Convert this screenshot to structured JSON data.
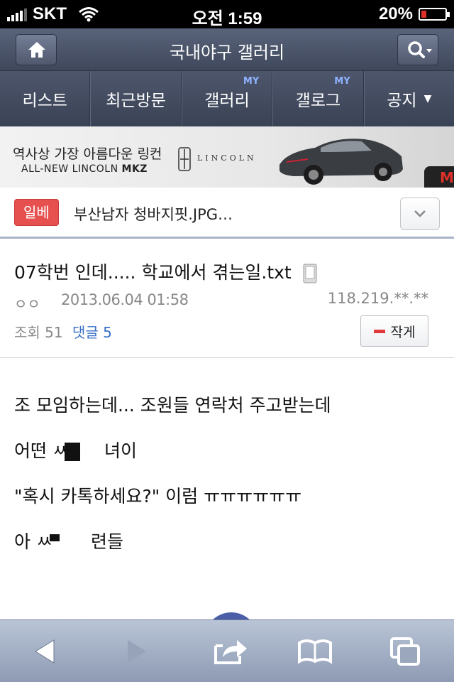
{
  "status_bar": {
    "carrier": "SKT",
    "time": "오전 1:59",
    "battery_text": "20%",
    "battery_level": 0.2
  },
  "header": {
    "title": "국내야구 갤러리",
    "home_icon": "home-icon",
    "search_icon": "search-icon"
  },
  "tabs": [
    {
      "label": "리스트",
      "my": ""
    },
    {
      "label": "최근방문",
      "my": ""
    },
    {
      "label": "갤러리",
      "my": "MY"
    },
    {
      "label": "갤로그",
      "my": "MY"
    },
    {
      "label": "공지",
      "my": ""
    }
  ],
  "ad": {
    "headline": "역사상 가장 아름다운 링컨",
    "subline": "ALL-NEW LINCOLN",
    "model": "MKZ",
    "brand": "LINCOLN",
    "corner": "M"
  },
  "breadcrumb": {
    "badge": "일베",
    "title": "부산남자 청바지핏.JPG…"
  },
  "post": {
    "title": "07학번 인데..... 학교에서 겪는일.txt",
    "author": "ㅇㅇ",
    "date": "2013.06.04 01:58",
    "ip": "118.219.**.**",
    "views": "조회 51",
    "comments": "댓글 5",
    "write_label": "작게"
  },
  "body": {
    "lines": [
      "조 모임하는데... 조원들 연락처 주고받는데",
      "어떤 ㅆ",
      "녀이",
      "\"혹시 카톡하세요?\" 이럼 ㅠㅠㅠㅠㅠㅠ",
      "아 ㅆ",
      "련들"
    ]
  },
  "colors": {
    "header": "#4a536a",
    "badge": "#e6504f",
    "link": "#3a72c6",
    "toolbar": "#a4b0c5"
  }
}
